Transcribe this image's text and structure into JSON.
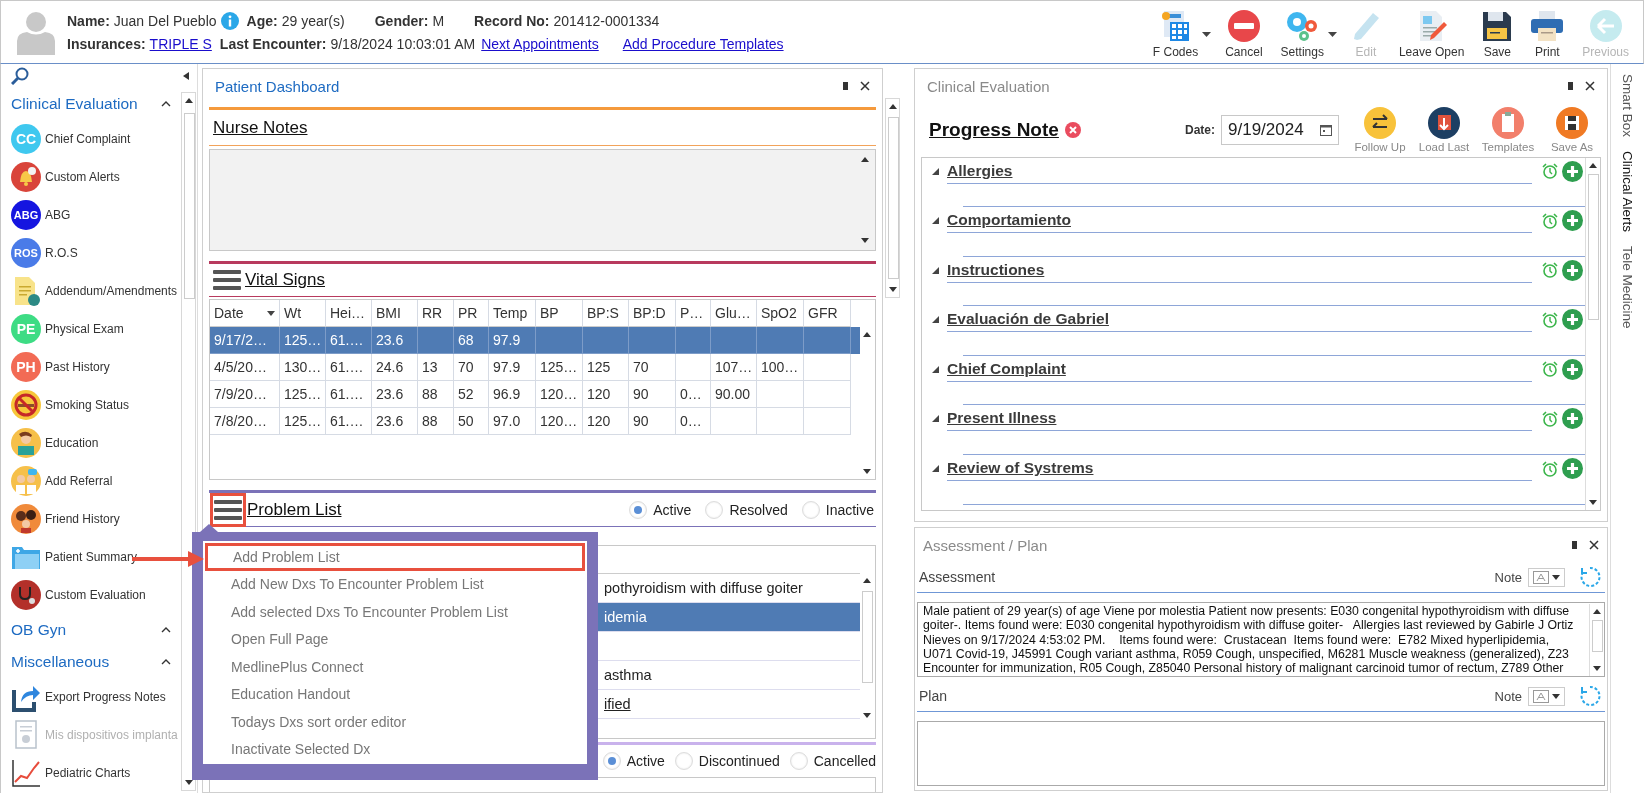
{
  "patient": {
    "name_label": "Name:",
    "name": "Juan Del Pueblo",
    "age_label": "Age:",
    "age": "29 year(s)",
    "gender_label": "Gender:",
    "gender": "M",
    "record_label": "Record No:",
    "record": "201412-0001334",
    "insurances_label": "Insurances:",
    "insurance": "TRIPLE S",
    "last_encounter_label": "Last Encounter:",
    "last_encounter": "9/18/2024 10:03:01 AM",
    "links": [
      "Next Appointments",
      "Add Procedure Templates"
    ]
  },
  "toolbar": [
    {
      "label": "F Codes",
      "kind": "calculator",
      "disabled": false,
      "dropdown": true
    },
    {
      "label": "Cancel",
      "kind": "cancel",
      "disabled": false,
      "dropdown": false
    },
    {
      "label": "Settings",
      "kind": "settings",
      "disabled": false,
      "dropdown": true
    },
    {
      "label": "Edit",
      "kind": "edit",
      "disabled": true,
      "dropdown": false
    },
    {
      "label": "Leave Open",
      "kind": "leave",
      "disabled": false,
      "dropdown": false
    },
    {
      "label": "Save",
      "kind": "save",
      "disabled": false,
      "dropdown": false
    },
    {
      "label": "Print",
      "kind": "print",
      "disabled": false,
      "dropdown": false
    },
    {
      "label": "Previous",
      "kind": "previous",
      "disabled": true,
      "dropdown": false
    }
  ],
  "sidebar": {
    "groups": [
      {
        "title": "Clinical Evaluation",
        "expanded": true,
        "items": [
          {
            "label": "Chief Complaint",
            "kind": "badge",
            "badge": "CC",
            "color": "#3fc8ef",
            "disabled": false
          },
          {
            "label": "Custom Alerts",
            "kind": "bell",
            "disabled": false
          },
          {
            "label": "ABG",
            "kind": "badge",
            "badge": "ABG",
            "color": "#1515e0",
            "disabled": false
          },
          {
            "label": "R.O.S",
            "kind": "badge",
            "badge": "ROS",
            "color": "#4a7be8",
            "disabled": false
          },
          {
            "label": "Addendum/Amendments",
            "kind": "document",
            "disabled": false
          },
          {
            "label": "Physical Exam",
            "kind": "badge",
            "badge": "PE",
            "color": "#3ddc84",
            "disabled": false
          },
          {
            "label": "Past History",
            "kind": "badge",
            "badge": "PH",
            "color": "#f26b55",
            "disabled": false
          },
          {
            "label": "Smoking Status",
            "kind": "nosmoking",
            "disabled": false
          },
          {
            "label": "Education",
            "kind": "reader",
            "disabled": false
          },
          {
            "label": "Add Referral",
            "kind": "doctors",
            "disabled": false
          },
          {
            "label": "Friend History",
            "kind": "family",
            "disabled": false
          },
          {
            "label": "Patient Summary",
            "kind": "folder",
            "disabled": false
          },
          {
            "label": "Custom Evaluation",
            "kind": "stethoscope",
            "disabled": false
          }
        ]
      },
      {
        "title": "OB Gyn",
        "expanded": true
      },
      {
        "title": "Miscellaneous",
        "expanded": true,
        "items": [
          {
            "label": "Export Progress Notes",
            "kind": "export",
            "disabled": false
          },
          {
            "label": "Mis dispositivos implanta",
            "kind": "certificate",
            "disabled": true
          },
          {
            "label": "Pediatric Charts",
            "kind": "chart",
            "disabled": false
          }
        ]
      }
    ]
  },
  "dashboard": {
    "title": "Patient Dashboard",
    "nurse_notes": {
      "title": "Nurse Notes"
    },
    "vital_signs": {
      "title": "Vital Signs",
      "columns": [
        "Date",
        "Wt",
        "Hei…",
        "BMI",
        "RR",
        "PR",
        "Temp",
        "BP",
        "BP:S",
        "BP:D",
        "P…",
        "Glu…",
        "SpO2",
        "GFR"
      ],
      "rows": [
        {
          "selected": true,
          "cells": [
            "9/17/2…",
            "125…",
            "61.…",
            "23.6",
            "",
            "68",
            "97.9",
            "",
            "",
            "",
            "",
            "",
            "",
            ""
          ]
        },
        {
          "selected": false,
          "cells": [
            "4/5/20…",
            "130…",
            "61.…",
            "24.6",
            "13",
            "70",
            "97.9",
            "125…",
            "125",
            "70",
            "",
            "107…",
            "100…",
            ""
          ]
        },
        {
          "selected": false,
          "cells": [
            "7/9/20…",
            "125…",
            "61.…",
            "23.6",
            "88",
            "52",
            "96.9",
            "120…",
            "120",
            "90",
            "0…",
            "90.00",
            "",
            ""
          ]
        },
        {
          "selected": false,
          "cells": [
            "7/8/20…",
            "125…",
            "61.…",
            "23.6",
            "88",
            "50",
            "97.0",
            "120…",
            "120",
            "90",
            "0…",
            "",
            "",
            ""
          ]
        }
      ]
    },
    "problem_list": {
      "title": "Problem List",
      "menu_button_highlighted": true,
      "filters": [
        {
          "label": "Active",
          "selected": true
        },
        {
          "label": "Resolved",
          "selected": false
        },
        {
          "label": "Inactive",
          "selected": false
        }
      ],
      "rows": [
        {
          "text": "pothyroidism with diffuse goiter",
          "selected": false,
          "link": false
        },
        {
          "text": "idemia",
          "selected": true,
          "link": false
        },
        {
          "selected": false
        },
        {
          "text": "asthma",
          "selected": false,
          "link": false
        },
        {
          "text": "ified",
          "selected": false,
          "link": true
        }
      ],
      "menu": {
        "callout_arrow": true,
        "items": [
          {
            "label": "Add Problem List",
            "selected": true
          },
          {
            "label": "Add New Dxs To Encounter Problem List",
            "selected": false
          },
          {
            "label": "Add selected Dxs To Encounter Problem List",
            "selected": false
          },
          {
            "label": "Open Full Page",
            "selected": false
          },
          {
            "label": "MedlinePlus Connect",
            "selected": false
          },
          {
            "label": "Education Handout",
            "selected": false
          },
          {
            "label": "Todays Dxs sort order editor",
            "selected": false
          },
          {
            "label": "Inactivate Selected Dx",
            "selected": false
          }
        ]
      }
    },
    "medications": {
      "filters": [
        {
          "label": "Active",
          "selected": true
        },
        {
          "label": "Discontinued",
          "selected": false
        },
        {
          "label": "Cancelled",
          "selected": false
        }
      ]
    }
  },
  "clinical_evaluation": {
    "title": "Clinical Evaluation",
    "note_title": "Progress Note",
    "date_label": "Date:",
    "date": "9/19/2024",
    "actions": [
      {
        "label": "Follow Up",
        "kind": "swap",
        "color": "#f8c23a"
      },
      {
        "label": "Load Last",
        "kind": "load",
        "color": "#1d3f63"
      },
      {
        "label": "Templates",
        "kind": "clipboard",
        "color": "#f27f6b"
      },
      {
        "label": "Save As",
        "kind": "save",
        "color": "#f07a24"
      }
    ],
    "sections": [
      {
        "title": "Allergies",
        "expanded": true
      },
      {
        "title": "Comportamiento",
        "expanded": true
      },
      {
        "title": "Instructiones",
        "expanded": true
      },
      {
        "title": "Evaluación de Gabriel",
        "expanded": true
      },
      {
        "title": "Chief Complaint",
        "expanded": true
      },
      {
        "title": "Present Illness",
        "expanded": true
      },
      {
        "title": "Review of Systrems",
        "expanded": true
      }
    ]
  },
  "assessment_plan": {
    "title": "Assessment / Plan",
    "assessment_label": "Assessment",
    "note_label": "Note",
    "assessment_lines": [
      "Male patient of 29 year(s) of age Viene por molestia Patient now presents: E030 congenital hypothyroidism with diffuse",
      "goiter-. Items found were: E030 congenital hypothyroidism with diffuse goiter-   Allergies last reviewed by Gabirle J Ortiz",
      "Nieves on 9/17/2024 4:53:02 PM.    Items found were:  Crustacean  Items found were:  E782 Mixed hyperlipidemia,",
      "U071 Covid-19, J45991 Cough variant asthma, R059 Cough, unspecified, M6281 Muscle weakness (generalized), Z23",
      "Encounter for immunization, R05 Cough, Z85040 Personal history of malignant carcinoid tumor of rectum, Z789 Other"
    ],
    "plan_label": "Plan",
    "plan_note_label": "Note"
  },
  "side_tabs": [
    {
      "label": "Smart Box",
      "selected": false
    },
    {
      "label": "Clinical Alerts",
      "selected": true
    },
    {
      "label": "Tele Medicine",
      "selected": false
    }
  ]
}
